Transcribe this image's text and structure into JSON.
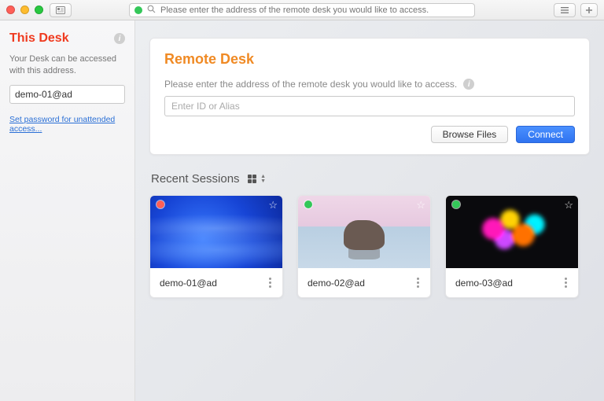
{
  "titlebar": {
    "address_placeholder": "Please enter the address of the remote desk you would like to access."
  },
  "sidebar": {
    "title": "This Desk",
    "desc": "Your Desk can be accessed with this address.",
    "address_value": "demo-01@ad",
    "password_link": "Set password for unattended access..."
  },
  "remote": {
    "title": "Remote Desk",
    "desc": "Please enter the address of the remote desk you would like to access.",
    "input_placeholder": "Enter ID or Alias",
    "browse_label": "Browse Files",
    "connect_label": "Connect"
  },
  "recent": {
    "title": "Recent Sessions",
    "items": [
      {
        "label": "demo-01@ad",
        "status": "busy",
        "variant": "blue"
      },
      {
        "label": "demo-02@ad",
        "status": "online",
        "variant": "lake"
      },
      {
        "label": "demo-03@ad",
        "status": "online",
        "variant": "splash"
      }
    ]
  }
}
